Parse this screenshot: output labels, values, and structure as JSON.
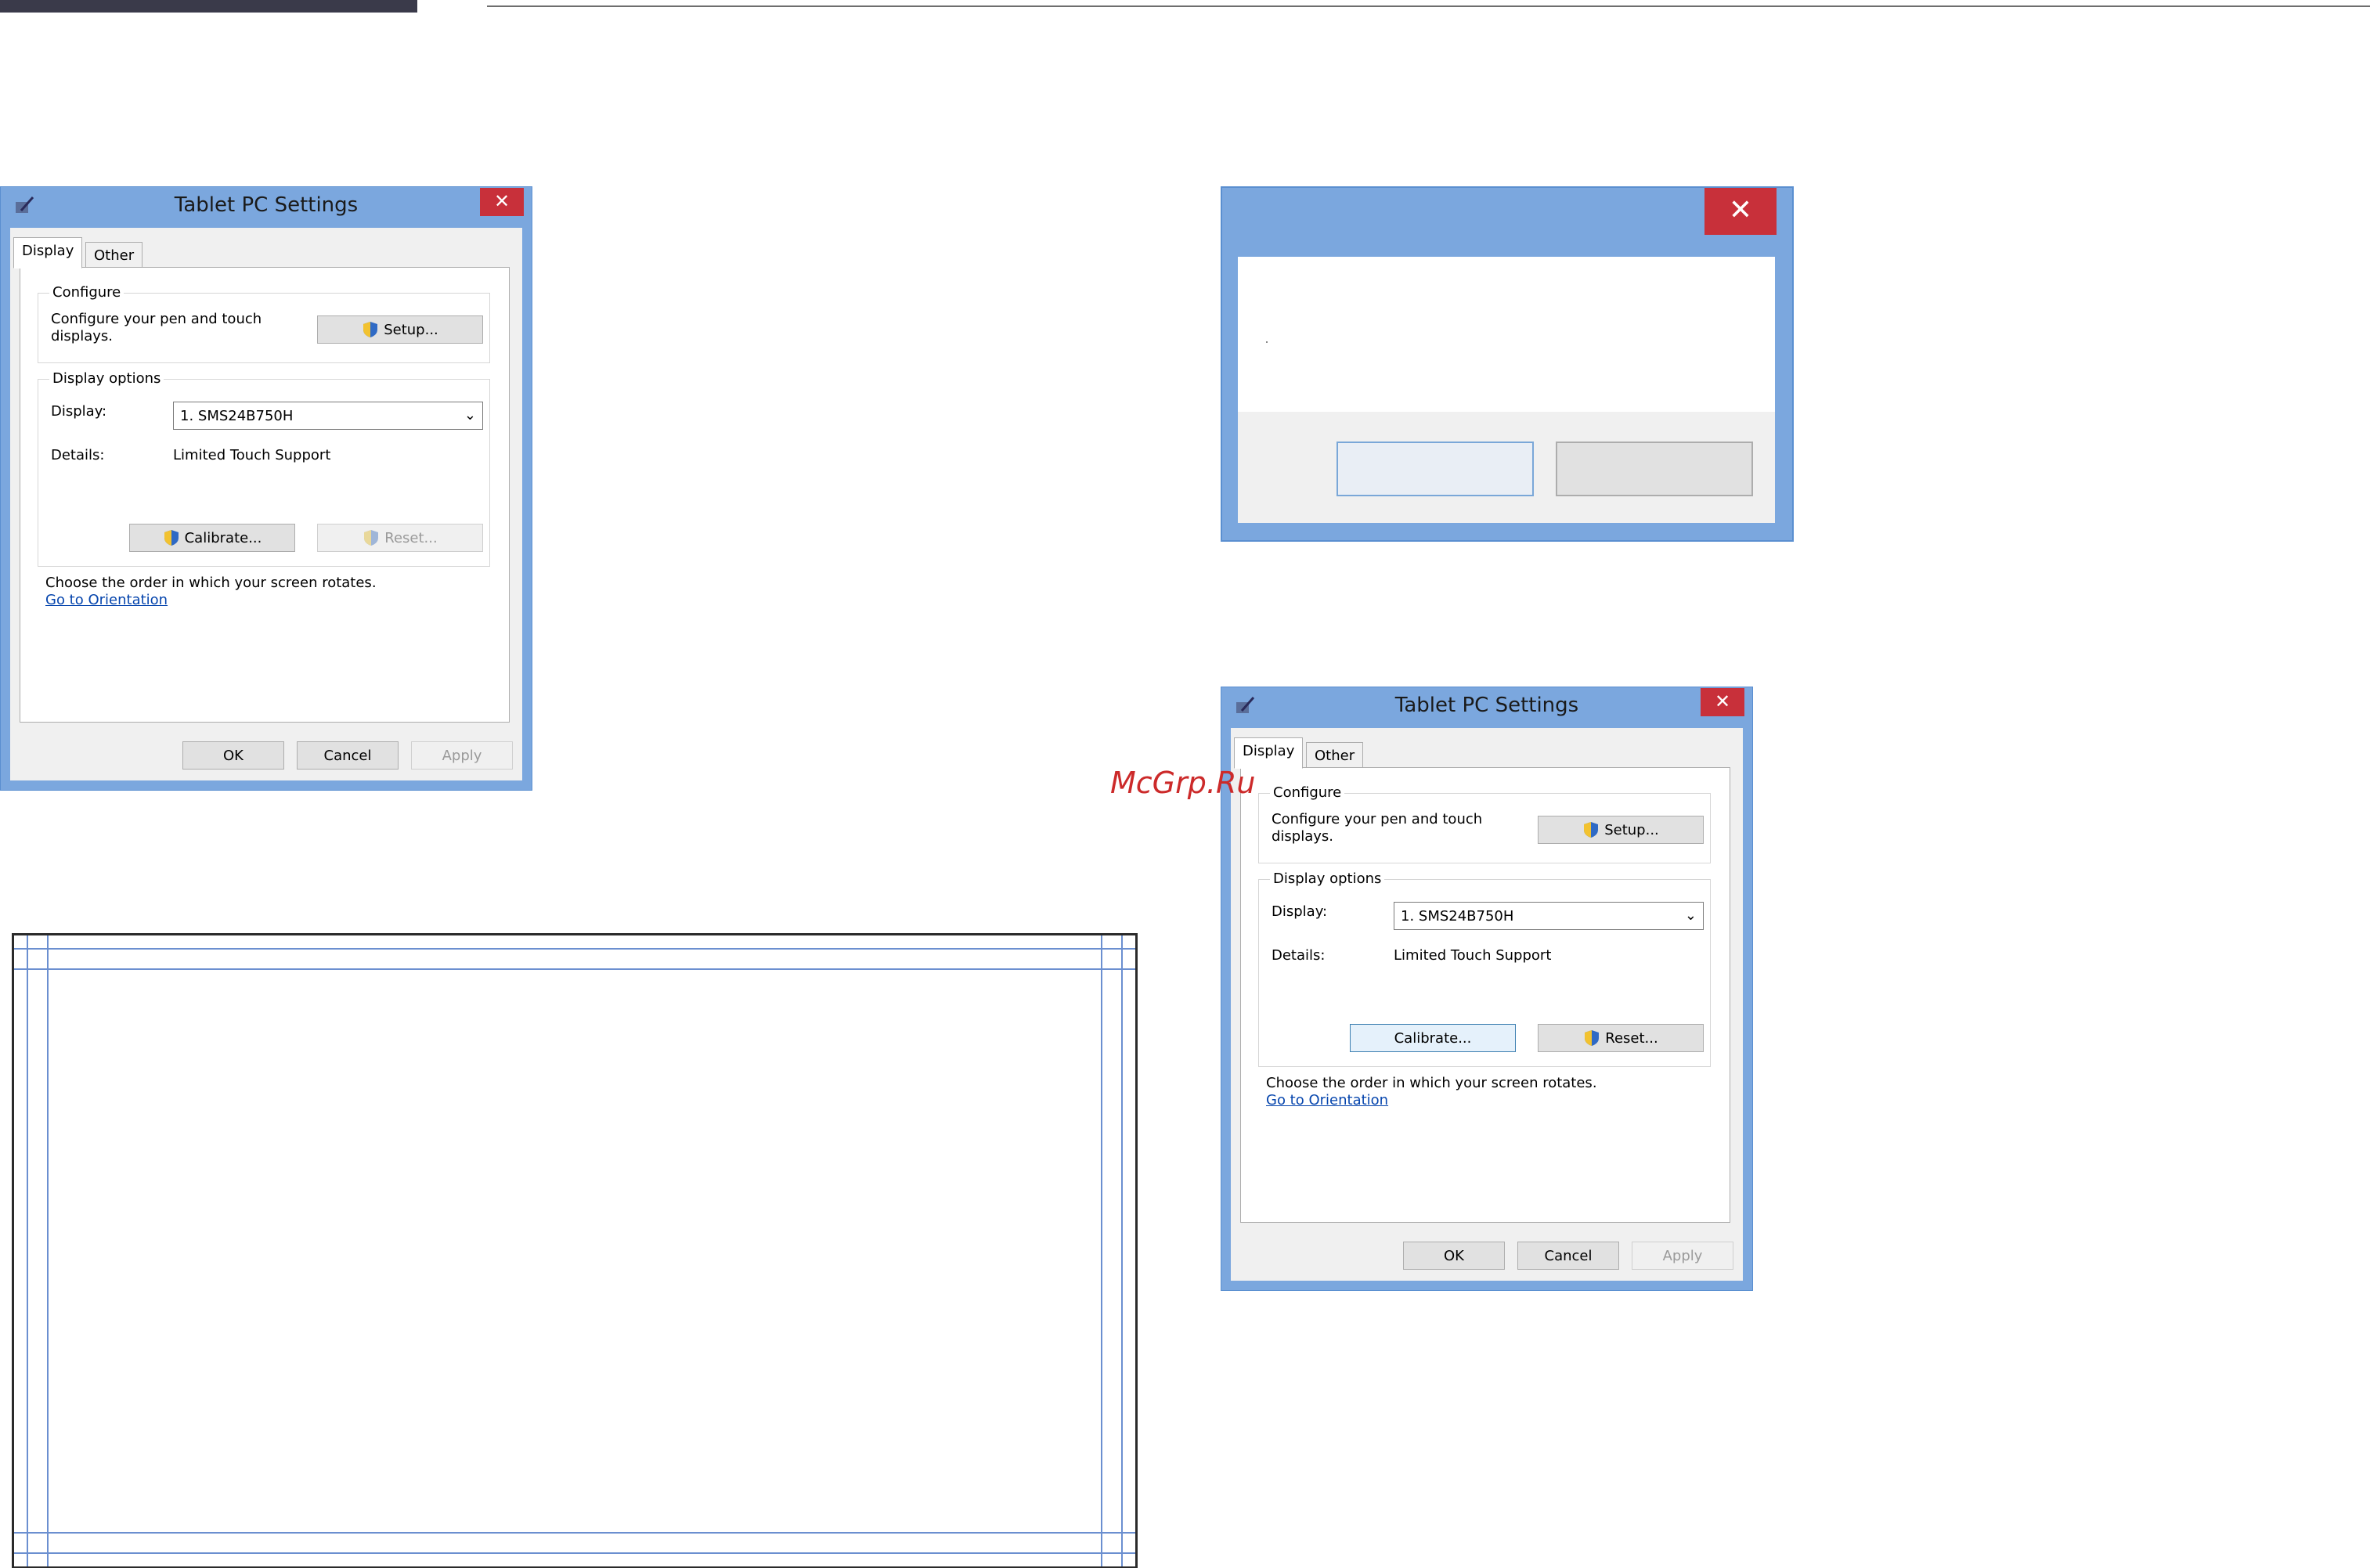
{
  "watermark": "McGrp.Ru",
  "tablet_window": {
    "title": "Tablet PC Settings",
    "close_glyph": "✕",
    "tabs": [
      "Display",
      "Other"
    ],
    "configure": {
      "legend": "Configure",
      "desc_line1": "Configure your pen and touch",
      "desc_line2": "displays.",
      "setup_label": "Setup..."
    },
    "display_options": {
      "legend": "Display options",
      "display_label": "Display:",
      "display_value": "1. SMS24B750H",
      "details_label": "Details:",
      "details_value": "Limited Touch Support",
      "calibrate_label": "Calibrate...",
      "reset_label": "Reset..."
    },
    "orientation_text": "Choose the order in which your screen rotates.",
    "orientation_link": "Go to Orientation",
    "ok_label": "OK",
    "cancel_label": "Cancel",
    "apply_label": "Apply"
  },
  "blank_dialog": {
    "close_glyph": "✕"
  },
  "colors": {
    "window_frame": "#7ba7de",
    "close_red": "#c8303a",
    "link_blue": "#0645ad",
    "watermark_red": "#cc2a2a"
  },
  "icons": [
    "tablet-pen-icon",
    "uac-shield-icon",
    "chevron-down-icon",
    "close-icon"
  ]
}
